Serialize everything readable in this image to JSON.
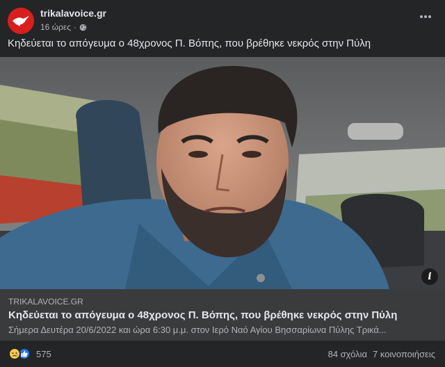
{
  "post": {
    "page_name": "trikalavoice.gr",
    "time": "16 ώρες",
    "separator": "·",
    "privacy_icon": "globe-icon",
    "caption": "Κηδεύεται το απόγευμα ο 48χρονος Π. Βόπης, που βρέθηκε νεκρός στην Πύλη"
  },
  "link": {
    "domain": "TRIKALAVOICE.GR",
    "title": "Κηδεύεται το απόγευμα ο 48χρονος Π. Βόπης, που βρέθηκε νεκρός στην Πύλη",
    "description": "Σήμερα Δευτέρα 20/6/2022 και ώρα 6:30 μ.μ. στον Ιερό Ναό Αγίου Βησσαρίωνα Πύλης Τρικά...",
    "info_label": "i"
  },
  "footer": {
    "reaction_icons": [
      "sad-reaction-icon",
      "like-reaction-icon"
    ],
    "reaction_count": "575",
    "comments": "84 σχόλια",
    "shares": "7 κοινοποιήσεις"
  },
  "colors": {
    "background": "#242526",
    "link_box": "#3a3b3c",
    "brand_red": "#d91e1e",
    "like_blue": "#2078f4",
    "sad_yellow": "#f7c84a"
  }
}
